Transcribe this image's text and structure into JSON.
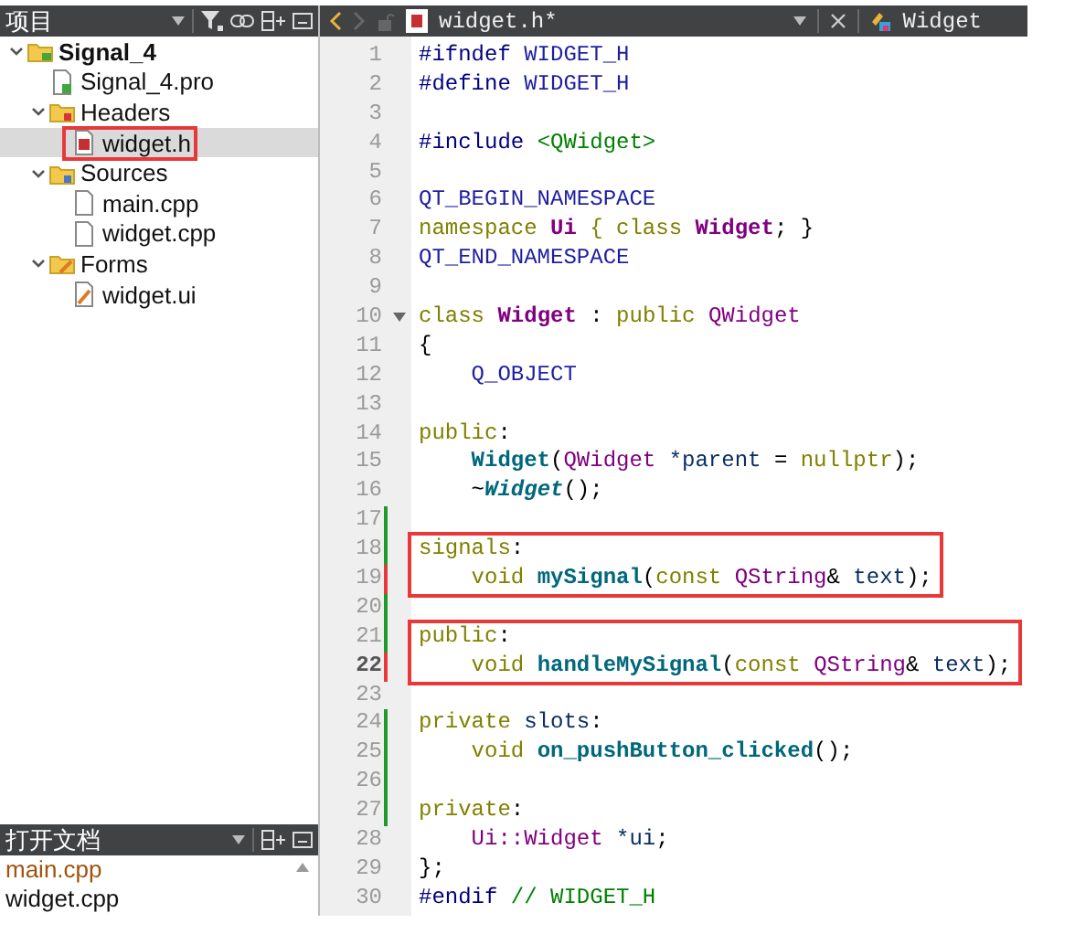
{
  "project_panel": {
    "title": "项目",
    "tree": [
      {
        "label": "Signal_4",
        "kind": "project",
        "expanded": true,
        "selected": false,
        "boxed": false,
        "children": [
          {
            "label": "Signal_4.pro",
            "kind": "pro-file",
            "selected": false,
            "boxed": false
          },
          {
            "label": "Headers",
            "kind": "header-folder",
            "expanded": true,
            "selected": false,
            "boxed": false,
            "children": [
              {
                "label": "widget.h",
                "kind": "header-file",
                "selected": true,
                "boxed": true
              }
            ]
          },
          {
            "label": "Sources",
            "kind": "source-folder",
            "expanded": true,
            "selected": false,
            "boxed": false,
            "children": [
              {
                "label": "main.cpp",
                "kind": "source-file",
                "selected": false,
                "boxed": false
              },
              {
                "label": "widget.cpp",
                "kind": "source-file",
                "selected": false,
                "boxed": false
              }
            ]
          },
          {
            "label": "Forms",
            "kind": "form-folder",
            "expanded": true,
            "selected": false,
            "boxed": false,
            "children": [
              {
                "label": "widget.ui",
                "kind": "form-file",
                "selected": false,
                "boxed": false
              }
            ]
          }
        ]
      }
    ]
  },
  "open_documents": {
    "title": "打开文档",
    "items": [
      {
        "label": "main.cpp",
        "highlighted": true
      },
      {
        "label": "widget.cpp",
        "highlighted": false
      }
    ]
  },
  "editor": {
    "back_enabled": true,
    "forward_enabled": false,
    "file_tab": "widget.h*",
    "class_label": "Widget",
    "lines": [
      {
        "number": "1",
        "current": false,
        "foldable": false,
        "boxed": false,
        "tokens": [
          {
            "kind": "preproc",
            "text": "#ifndef "
          },
          {
            "kind": "macro",
            "text": "WIDGET_H"
          }
        ]
      },
      {
        "number": "2",
        "current": false,
        "foldable": false,
        "boxed": false,
        "tokens": [
          {
            "kind": "preproc",
            "text": "#define "
          },
          {
            "kind": "macro",
            "text": "WIDGET_H"
          }
        ]
      },
      {
        "number": "3",
        "current": false,
        "foldable": false,
        "boxed": false
      },
      {
        "number": "4",
        "current": false,
        "foldable": false,
        "boxed": false,
        "tokens": [
          {
            "kind": "preproc",
            "text": "#include "
          },
          {
            "kind": "string",
            "text": "<QWidget>"
          }
        ]
      },
      {
        "number": "5",
        "current": false,
        "foldable": false,
        "boxed": false
      },
      {
        "number": "6",
        "current": false,
        "foldable": false,
        "boxed": false,
        "tokens": [
          {
            "kind": "macro",
            "text": "QT_BEGIN_NAMESPACE"
          }
        ]
      },
      {
        "number": "7",
        "current": false,
        "foldable": false,
        "boxed": false,
        "tokens": [
          {
            "kind": "keyword",
            "text": "namespace "
          },
          {
            "kind": "class-name",
            "text": "Ui "
          },
          {
            "kind": "keyword",
            "text": "{ class "
          },
          {
            "kind": "class-name",
            "text": "Widget"
          },
          {
            "kind": "plain",
            "text": "; }"
          }
        ]
      },
      {
        "number": "8",
        "current": false,
        "foldable": false,
        "boxed": false,
        "tokens": [
          {
            "kind": "macro",
            "text": "QT_END_NAMESPACE"
          }
        ]
      },
      {
        "number": "9",
        "current": false,
        "foldable": false,
        "boxed": false
      },
      {
        "number": "10",
        "current": false,
        "foldable": true,
        "boxed": false,
        "tokens": [
          {
            "kind": "keyword",
            "text": "class "
          },
          {
            "kind": "class-name",
            "text": "Widget"
          },
          {
            "kind": "plain",
            "text": " : "
          },
          {
            "kind": "keyword",
            "text": "public "
          },
          {
            "kind": "type",
            "text": "QWidget"
          }
        ]
      },
      {
        "number": "11",
        "current": false,
        "foldable": false,
        "boxed": false,
        "tokens": [
          {
            "kind": "plain",
            "text": "{"
          }
        ]
      },
      {
        "number": "12",
        "current": false,
        "foldable": false,
        "boxed": false,
        "tokens": [
          {
            "kind": "macro",
            "text": "    Q_OBJECT"
          }
        ]
      },
      {
        "number": "13",
        "current": false,
        "foldable": false,
        "boxed": false
      },
      {
        "number": "14",
        "current": false,
        "foldable": false,
        "boxed": false,
        "tokens": [
          {
            "kind": "keyword",
            "text": "public"
          },
          {
            "kind": "plain",
            "text": ":"
          }
        ]
      },
      {
        "number": "15",
        "current": false,
        "foldable": false,
        "boxed": false,
        "tokens": [
          {
            "kind": "function",
            "text": "    Widget"
          },
          {
            "kind": "plain",
            "text": "("
          },
          {
            "kind": "type",
            "text": "QWidget "
          },
          {
            "kind": "variable",
            "text": "*parent"
          },
          {
            "kind": "plain",
            "text": " = "
          },
          {
            "kind": "keyword",
            "text": "nullptr"
          },
          {
            "kind": "plain",
            "text": ");"
          }
        ]
      },
      {
        "number": "16",
        "current": false,
        "foldable": false,
        "boxed": false,
        "tokens": [
          {
            "kind": "plain",
            "text": "    ~"
          },
          {
            "kind": "function-italic",
            "text": "Widget"
          },
          {
            "kind": "plain",
            "text": "();"
          }
        ]
      },
      {
        "number": "17",
        "modified": true,
        "unsaved": false,
        "current": false,
        "foldable": false,
        "boxed": false
      },
      {
        "number": "18",
        "modified": true,
        "unsaved": false,
        "current": false,
        "foldable": false,
        "boxed": true,
        "tokens": [
          {
            "kind": "keyword",
            "text": "signals"
          },
          {
            "kind": "plain",
            "text": ":"
          }
        ]
      },
      {
        "number": "19",
        "modified": true,
        "unsaved": true,
        "current": false,
        "foldable": false,
        "boxed": true,
        "tokens": [
          {
            "kind": "keyword",
            "text": "    void "
          },
          {
            "kind": "function",
            "text": "mySignal"
          },
          {
            "kind": "plain",
            "text": "("
          },
          {
            "kind": "keyword",
            "text": "const "
          },
          {
            "kind": "type",
            "text": "QString"
          },
          {
            "kind": "plain",
            "text": "& "
          },
          {
            "kind": "variable",
            "text": "text"
          },
          {
            "kind": "plain",
            "text": ");"
          }
        ]
      },
      {
        "number": "20",
        "modified": true,
        "unsaved": false,
        "current": false,
        "foldable": false,
        "boxed": false
      },
      {
        "number": "21",
        "modified": true,
        "unsaved": false,
        "current": false,
        "foldable": false,
        "boxed": true,
        "tokens": [
          {
            "kind": "keyword",
            "text": "public"
          },
          {
            "kind": "plain",
            "text": ":"
          }
        ]
      },
      {
        "number": "22",
        "modified": true,
        "unsaved": true,
        "current": true,
        "foldable": false,
        "boxed": true,
        "tokens": [
          {
            "kind": "keyword",
            "text": "    void "
          },
          {
            "kind": "function",
            "text": "handleMySignal"
          },
          {
            "kind": "plain",
            "text": "("
          },
          {
            "kind": "keyword",
            "text": "const "
          },
          {
            "kind": "type",
            "text": "QString"
          },
          {
            "kind": "plain",
            "text": "& "
          },
          {
            "kind": "variable",
            "text": "text"
          },
          {
            "kind": "plain",
            "text": ");"
          }
        ]
      },
      {
        "number": "23",
        "current": false,
        "foldable": false,
        "boxed": false
      },
      {
        "number": "24",
        "modified": true,
        "unsaved": false,
        "current": false,
        "foldable": false,
        "boxed": false,
        "tokens": [
          {
            "kind": "keyword",
            "text": "private "
          },
          {
            "kind": "variable",
            "text": "slots"
          },
          {
            "kind": "plain",
            "text": ":"
          }
        ]
      },
      {
        "number": "25",
        "modified": true,
        "unsaved": false,
        "current": false,
        "foldable": false,
        "boxed": false,
        "tokens": [
          {
            "kind": "keyword",
            "text": "    void "
          },
          {
            "kind": "function",
            "text": "on_pushButton_clicked"
          },
          {
            "kind": "plain",
            "text": "();"
          }
        ]
      },
      {
        "number": "26",
        "modified": true,
        "unsaved": false,
        "current": false,
        "foldable": false,
        "boxed": false
      },
      {
        "number": "27",
        "modified": true,
        "unsaved": false,
        "current": false,
        "foldable": false,
        "boxed": false,
        "tokens": [
          {
            "kind": "keyword",
            "text": "private"
          },
          {
            "kind": "plain",
            "text": ":"
          }
        ]
      },
      {
        "number": "28",
        "current": false,
        "foldable": false,
        "boxed": false,
        "tokens": [
          {
            "kind": "type",
            "text": "    Ui::Widget "
          },
          {
            "kind": "variable",
            "text": "*ui"
          },
          {
            "kind": "plain",
            "text": ";"
          }
        ]
      },
      {
        "number": "29",
        "current": false,
        "foldable": false,
        "boxed": false,
        "tokens": [
          {
            "kind": "plain",
            "text": "};"
          }
        ]
      },
      {
        "number": "30",
        "current": false,
        "foldable": false,
        "boxed": false,
        "tokens": [
          {
            "kind": "preproc",
            "text": "#endif "
          },
          {
            "kind": "comment",
            "text": "// WIDGET_H"
          }
        ]
      }
    ]
  }
}
